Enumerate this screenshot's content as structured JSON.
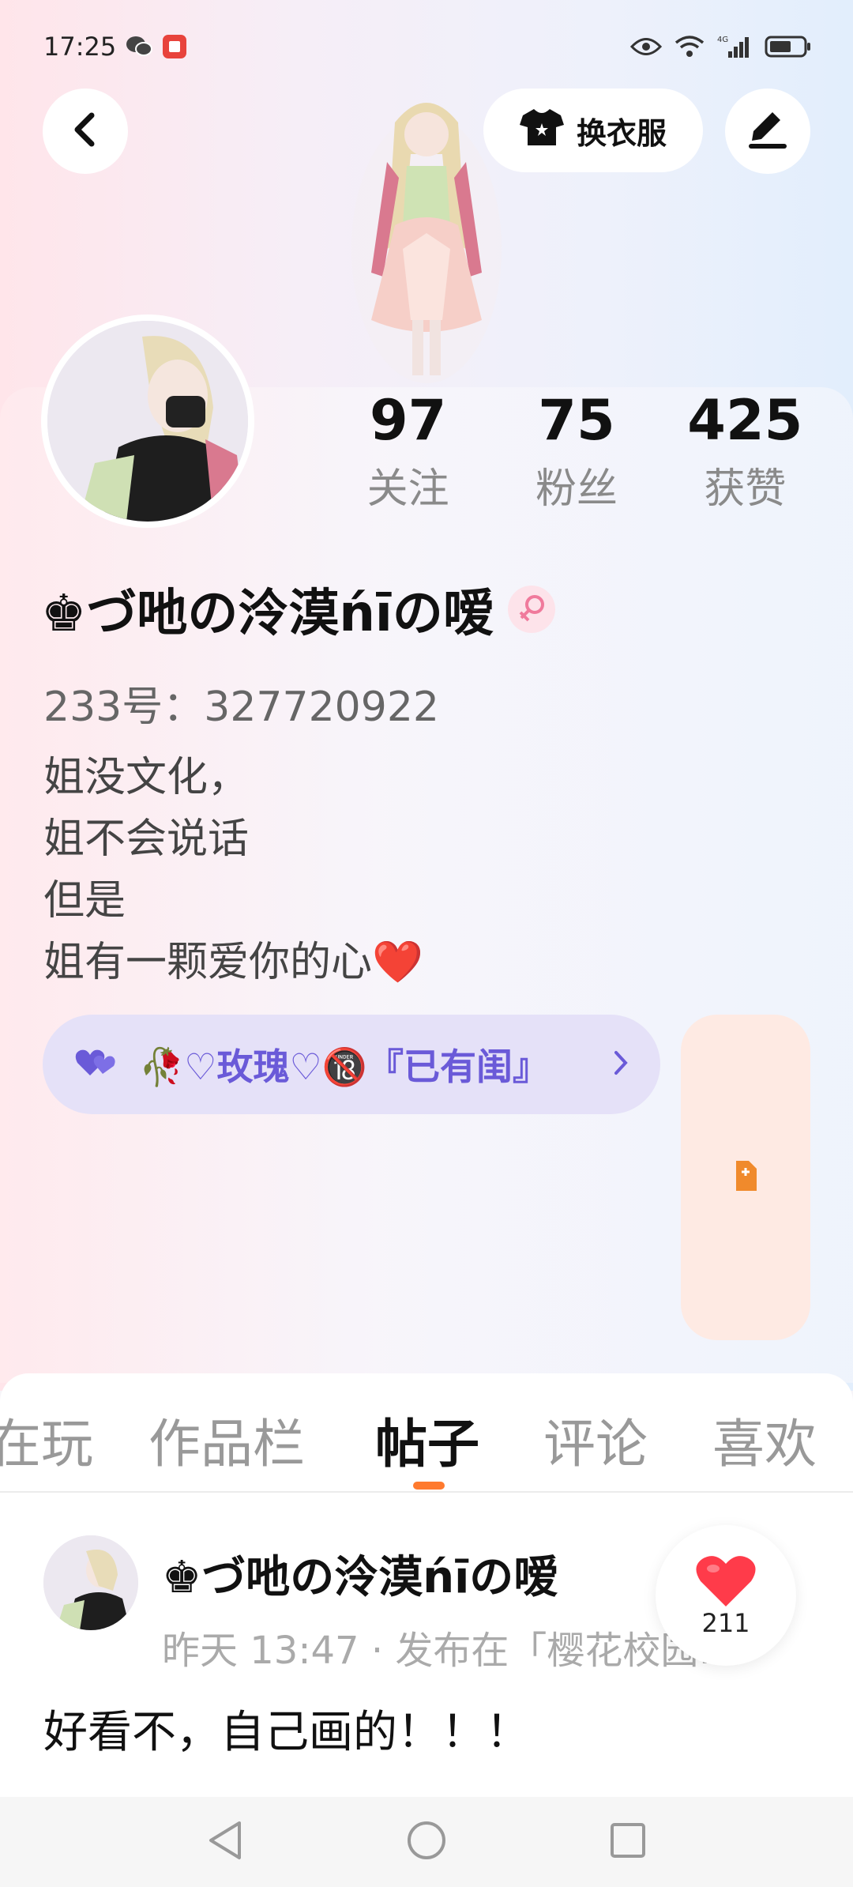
{
  "status_bar": {
    "time": "17:25",
    "network": "4G"
  },
  "header": {
    "dress_button_label": "换衣服"
  },
  "profile": {
    "stats": [
      {
        "value": "97",
        "label": "关注"
      },
      {
        "value": "75",
        "label": "粉丝"
      },
      {
        "value": "425",
        "label": "获赞"
      }
    ],
    "username": "♚づ吔の泠漠ńīの嗳",
    "uid": "233号：327720922",
    "bio": "姐没文化，\n姐不会说话\n但是\n姐有一颗爱你的心❤️",
    "guild": "🥀♡玫瑰♡🔞『已有闺』"
  },
  "tabs": [
    "在玩",
    "作品栏",
    "帖子",
    "评论",
    "喜欢"
  ],
  "active_tab": "帖子",
  "post": {
    "author": "♚づ吔の泠漠ńīの嗳",
    "meta": "昨天 13:47 · 发布在「樱花校园…",
    "text": "好看不，自己画的！！！",
    "likes": "211"
  },
  "colors": {
    "accent": "#ff7a2e",
    "guild_text": "#6a5ad8",
    "heart": "#ff3b4a"
  }
}
